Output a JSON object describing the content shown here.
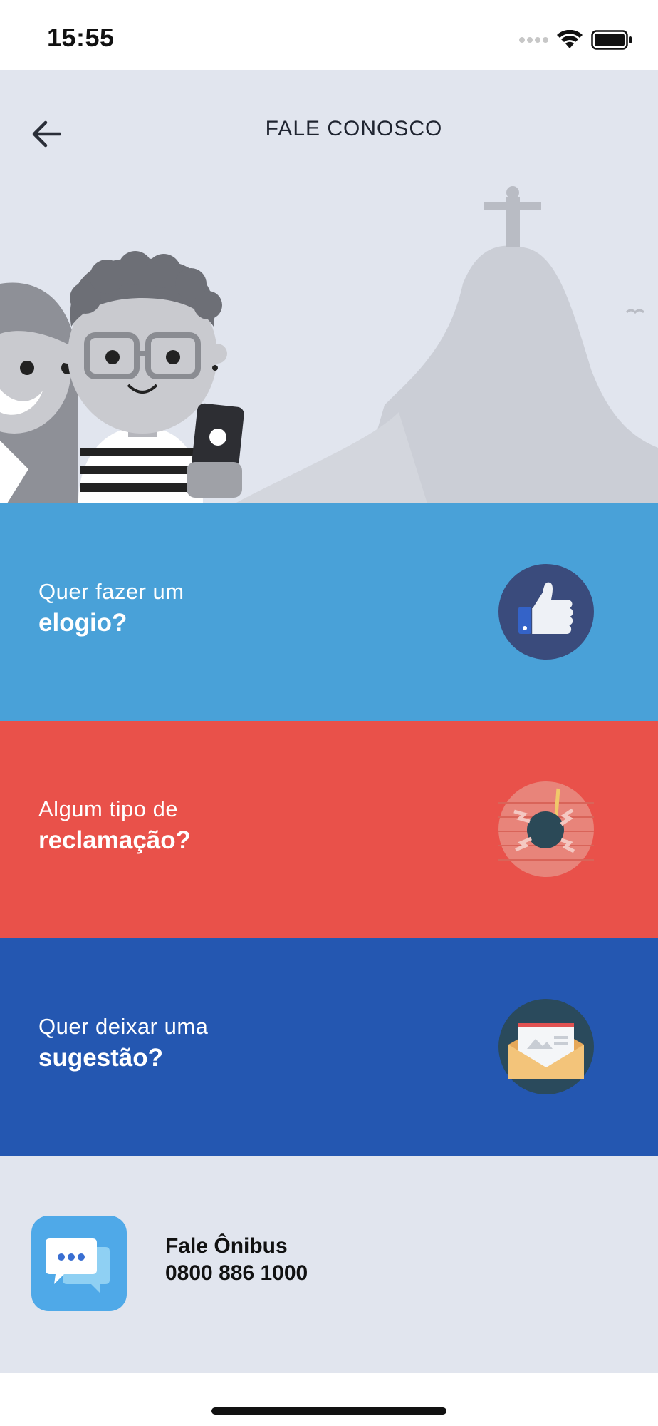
{
  "status_bar": {
    "time": "15:55",
    "icons": [
      "signal-icon",
      "wifi-icon",
      "battery-icon"
    ]
  },
  "header": {
    "title": "FALE CONOSCO",
    "back_icon": "back-arrow-icon"
  },
  "options": [
    {
      "line1": "Quer fazer um",
      "line2": "elogio?",
      "icon": "thumbs-up-icon",
      "color": "#49a1d8"
    },
    {
      "line1": "Algum tipo de",
      "line2": "reclamação?",
      "icon": "bomb-icon",
      "color": "#e9514a"
    },
    {
      "line1": "Quer deixar uma",
      "line2": "sugestão?",
      "icon": "envelope-icon",
      "color": "#2457b1"
    }
  ],
  "contact": {
    "name": "Fale Ônibus",
    "phone": "0800 886 1000",
    "icon": "chat-bubbles-icon",
    "background": "#e1e5ee"
  }
}
